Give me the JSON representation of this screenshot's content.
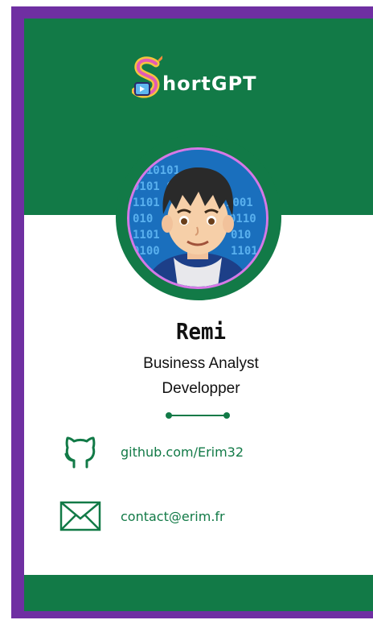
{
  "logo": {
    "text": "hortGPT",
    "icon": "shortgpt-s-logo-icon"
  },
  "profile": {
    "name": "Remi",
    "role_line1": "Business Analyst",
    "role_line2": "Developper",
    "avatar": "cartoon-avatar"
  },
  "contacts": {
    "github": {
      "icon": "github-icon",
      "text": "github.com/Erim32"
    },
    "email": {
      "icon": "envelope-icon",
      "text": "contact@erim.fr"
    }
  },
  "colors": {
    "frame": "#6f2fa2",
    "green": "#127a47",
    "avatar_border": "#d678e6"
  }
}
